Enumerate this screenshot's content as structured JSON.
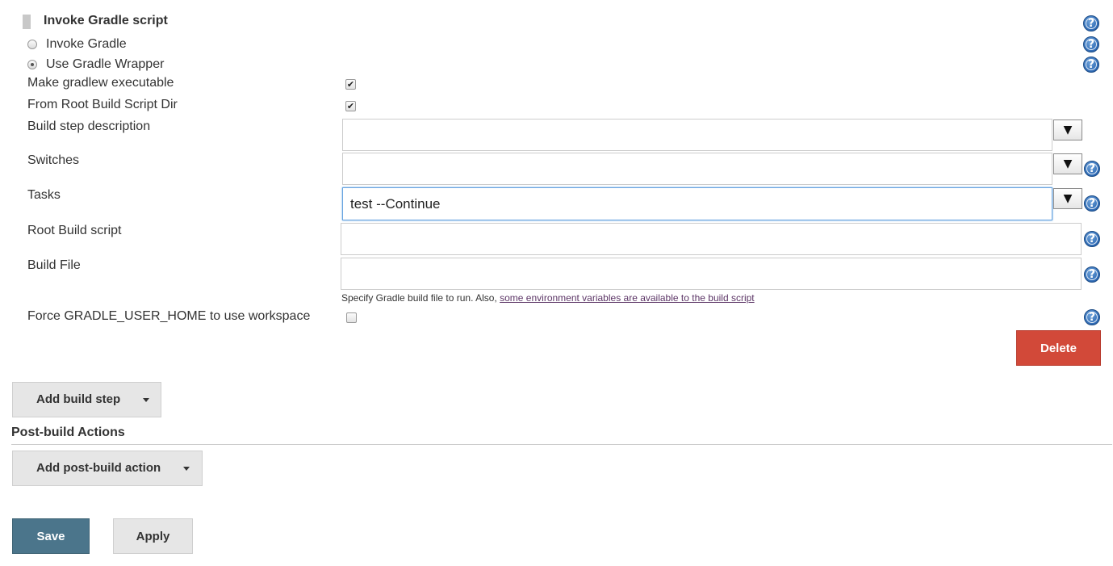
{
  "builder": {
    "title": "Invoke Gradle script",
    "radio_invoke_gradle": "Invoke Gradle",
    "radio_use_wrapper": "Use Gradle Wrapper",
    "selected_option": "Use Gradle Wrapper",
    "make_executable_label": "Make gradlew executable",
    "make_executable_checked": true,
    "from_root_label": "From Root Build Script Dir",
    "from_root_checked": true,
    "build_step_description_label": "Build step description",
    "build_step_description_value": "",
    "switches_label": "Switches",
    "switches_value": "",
    "tasks_label": "Tasks",
    "tasks_value": "test --Continue",
    "root_build_script_label": "Root Build script",
    "root_build_script_value": "",
    "build_file_label": "Build File",
    "build_file_value": "",
    "build_file_hint_text": "Specify Gradle build file to run. Also,",
    "build_file_hint_link": "some environment variables are available to the build script",
    "force_home_label": "Force GRADLE_USER_HOME to use workspace",
    "force_home_checked": false,
    "delete_label": "Delete",
    "expander_glyph": "▼",
    "help_glyph": "?",
    "check_glyph": "✔"
  },
  "add_build_step_label": "Add build step",
  "post_build": {
    "title": "Post-build Actions",
    "add_action_label": "Add post-build action"
  },
  "footer": {
    "save_label": "Save",
    "apply_label": "Apply"
  },
  "colors": {
    "delete": "#d24939",
    "save": "#4b758b",
    "focus_border": "#66a3e0",
    "link": "#5c3566",
    "help": "#2f6bb5"
  },
  "icons": {
    "drag_handle": "drag-handle-icon",
    "help": "help-icon",
    "expand": "expand-arrow-icon",
    "dropdown": "chevron-down-icon"
  }
}
